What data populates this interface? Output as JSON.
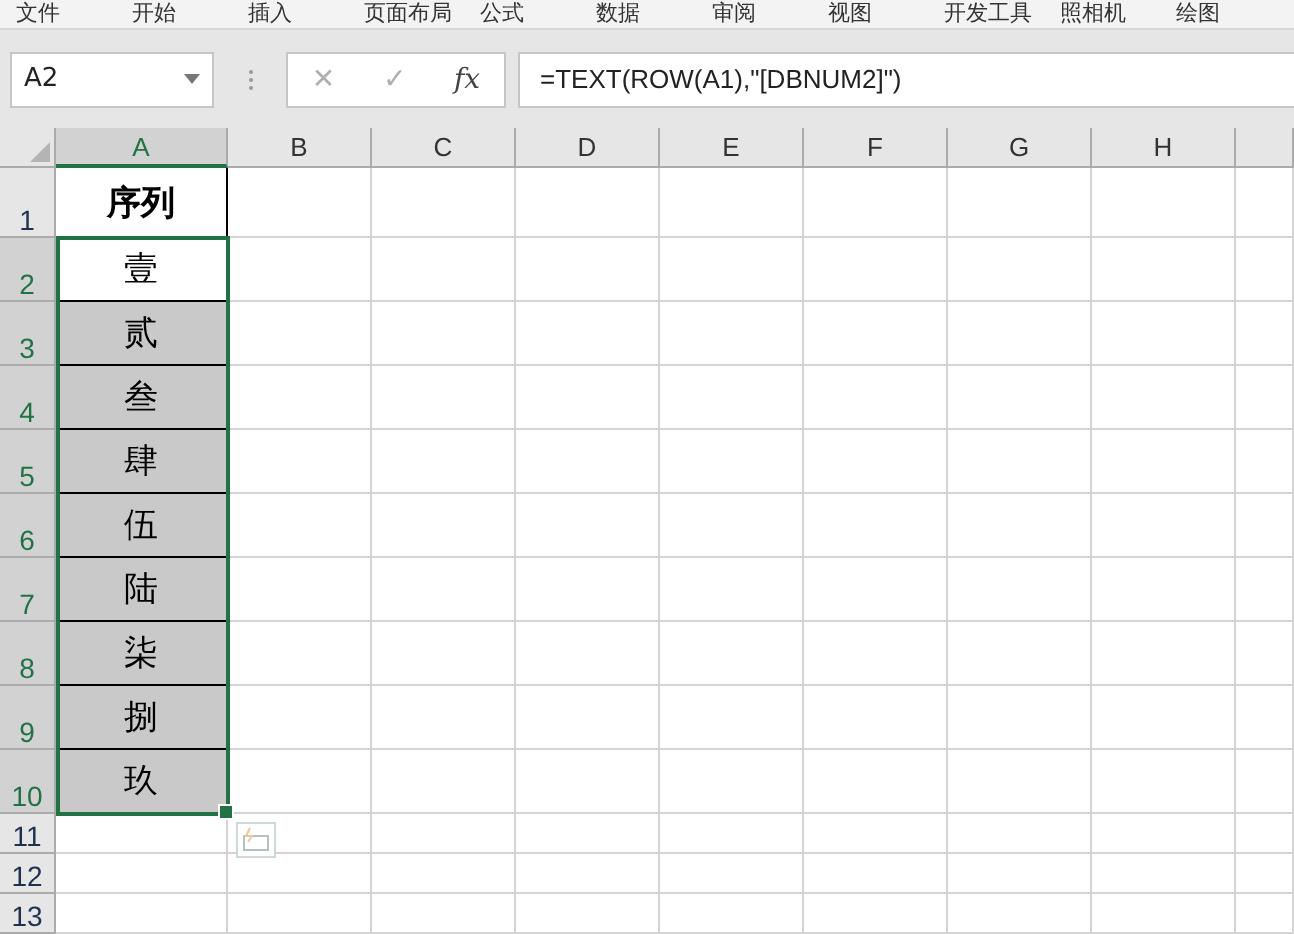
{
  "ribbon_tabs": [
    "文件",
    "开始",
    "插入",
    "页面布局",
    "公式",
    "数据",
    "审阅",
    "视图",
    "开发工具",
    "照相机",
    "绘图"
  ],
  "formula_bar": {
    "name_box": "A2",
    "cancel": "✕",
    "enter": "✓",
    "fx": "fx",
    "formula": "=TEXT(ROW(A1),\"[DBNUM2]\")"
  },
  "columns": [
    {
      "label": "A",
      "selected": true
    },
    {
      "label": "B",
      "selected": false
    },
    {
      "label": "C",
      "selected": false
    },
    {
      "label": "D",
      "selected": false
    },
    {
      "label": "E",
      "selected": false
    },
    {
      "label": "F",
      "selected": false
    },
    {
      "label": "G",
      "selected": false
    },
    {
      "label": "H",
      "selected": false
    }
  ],
  "rows": [
    {
      "number": "1",
      "selected": false,
      "a": "序列",
      "bold": true,
      "shaded": false
    },
    {
      "number": "2",
      "selected": true,
      "a": "壹",
      "bold": false,
      "shaded": false
    },
    {
      "number": "3",
      "selected": true,
      "a": "贰",
      "bold": false,
      "shaded": true
    },
    {
      "number": "4",
      "selected": true,
      "a": "叁",
      "bold": false,
      "shaded": true
    },
    {
      "number": "5",
      "selected": true,
      "a": "肆",
      "bold": false,
      "shaded": true
    },
    {
      "number": "6",
      "selected": true,
      "a": "伍",
      "bold": false,
      "shaded": true
    },
    {
      "number": "7",
      "selected": true,
      "a": "陆",
      "bold": false,
      "shaded": true
    },
    {
      "number": "8",
      "selected": true,
      "a": "柒",
      "bold": false,
      "shaded": true
    },
    {
      "number": "9",
      "selected": true,
      "a": "捌",
      "bold": false,
      "shaded": true
    },
    {
      "number": "10",
      "selected": true,
      "a": "玖",
      "bold": false,
      "shaded": true
    },
    {
      "number": "11",
      "selected": false
    },
    {
      "number": "12",
      "selected": false
    },
    {
      "number": "13",
      "selected": false
    }
  ]
}
